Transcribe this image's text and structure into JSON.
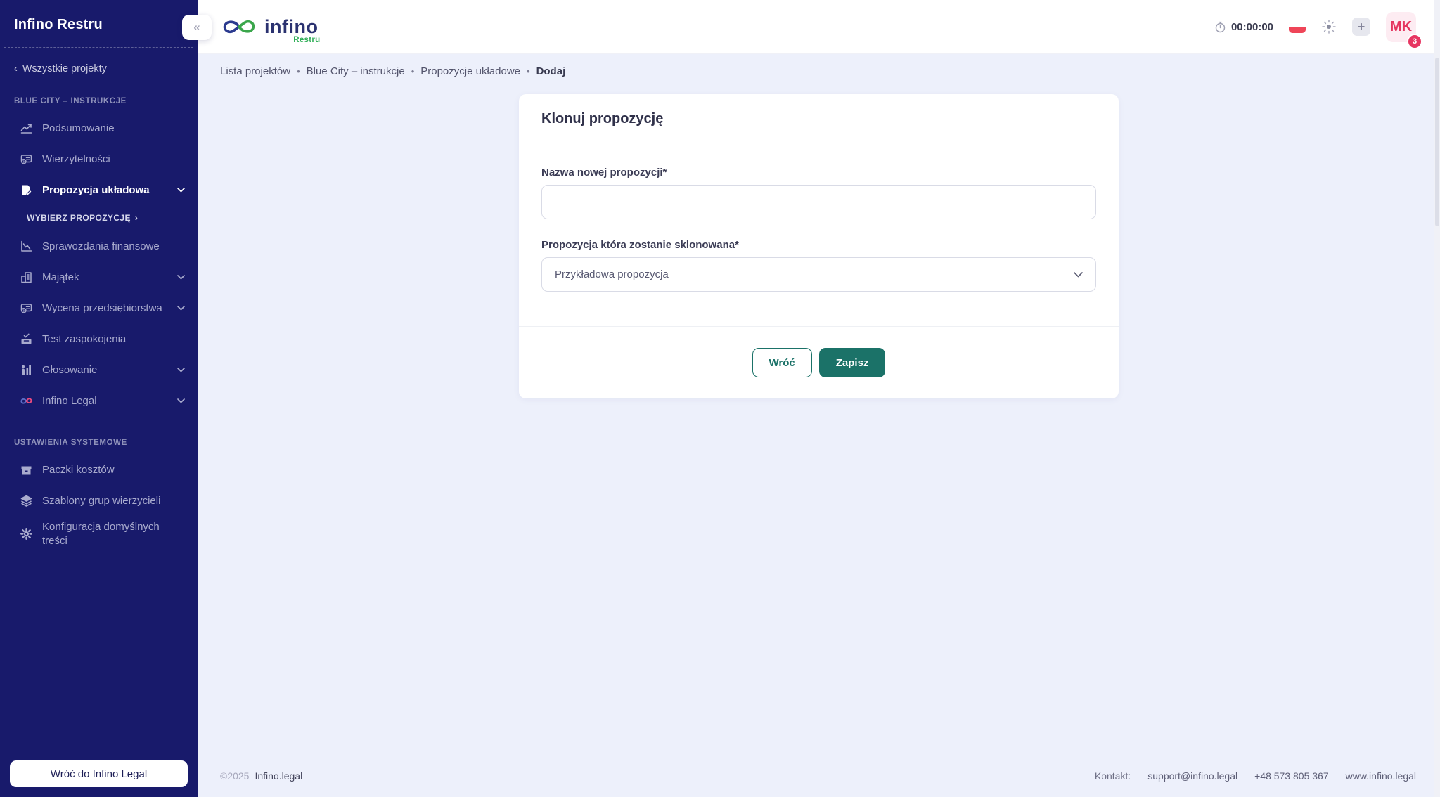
{
  "colors": {
    "sidebar_navy": "#181a6b",
    "teal": "#1b7268",
    "accent_pink": "#e5355f",
    "flag_red": "#ef4558",
    "main_bg": "#edf0fb",
    "logo_navy": "#2b3270",
    "logo_green": "#2fae57"
  },
  "icons": {
    "collapse": "«",
    "back_chevron": "‹",
    "forward_chevron": "›",
    "plus": "+"
  },
  "sidebar": {
    "title": "Infino Restru",
    "back_link": "Wszystkie projekty",
    "section_project": "BLUE CITY – INSTRUKCJE",
    "section_system": "USTAWIENIA SYSTEMOWE",
    "items": [
      {
        "label": "Podsumowanie"
      },
      {
        "label": "Wierzytelności"
      },
      {
        "label": "Propozycja układowa"
      },
      {
        "label": "WYBIERZ PROPOZYCJĘ"
      },
      {
        "label": "Sprawozdania finansowe"
      },
      {
        "label": "Majątek"
      },
      {
        "label": "Wycena przedsiębiorstwa"
      },
      {
        "label": "Test zaspokojenia"
      },
      {
        "label": "Głosowanie"
      },
      {
        "label": "Infino Legal"
      },
      {
        "label": "Paczki kosztów"
      },
      {
        "label": "Szablony grup wierzycieli"
      },
      {
        "label": "Konfiguracja domyślnych treści"
      }
    ],
    "footer_button": "Wróć do Infino Legal"
  },
  "header": {
    "logo_word": "infino",
    "logo_sub": "Restru",
    "timer": "00:00:00",
    "avatar_initials": "MK",
    "badge_count": "3"
  },
  "breadcrumb": {
    "items": [
      "Lista projektów",
      "Blue City – instrukcje",
      "Propozycje układowe",
      "Dodaj"
    ]
  },
  "main": {
    "card": {
      "title": "Klonuj propozycję",
      "name_label": "Nazwa nowej propozycji*",
      "name_value": "",
      "clone_label": "Propozycja która zostanie sklonowana*",
      "clone_value": "Przykładowa propozycja",
      "back_button": "Wróć",
      "save_button": "Zapisz"
    }
  },
  "footer": {
    "copyright": "©2025",
    "brand": "Infino.legal",
    "contact_label": "Kontakt:",
    "email": "support@infino.legal",
    "phone": "+48 573 805 367",
    "website": "www.infino.legal"
  }
}
